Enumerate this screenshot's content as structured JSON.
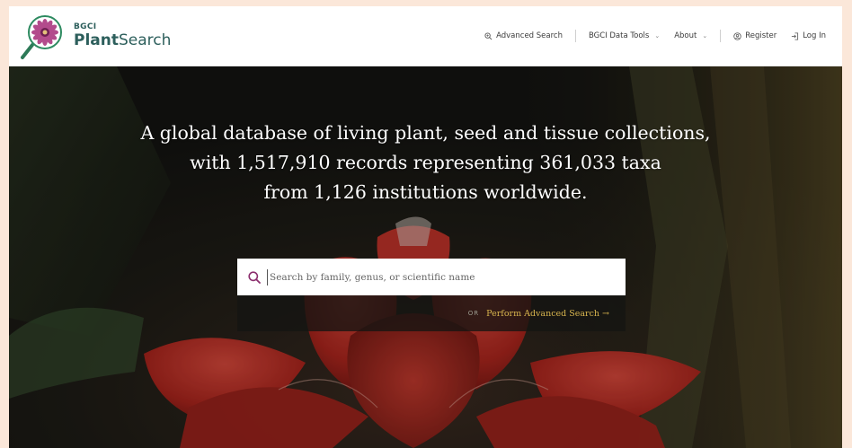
{
  "header": {
    "logo_small": "BGCI",
    "logo_name_bold": "Plant",
    "logo_name_rest": "Search",
    "nav": {
      "advanced_search": "Advanced Search",
      "data_tools": "BGCI Data Tools",
      "about": "About",
      "register": "Register",
      "login": "Log In"
    }
  },
  "hero": {
    "headline_line1": "A global database of living plant, seed and tissue collections,",
    "headline_line2": "with 1,517,910 records representing 361,033 taxa",
    "headline_line3": "from 1,126 institutions worldwide."
  },
  "search": {
    "placeholder": "Search by family, genus, or scientific name",
    "or_label": "OR",
    "advanced_link": "Perform Advanced Search →"
  },
  "colors": {
    "brand": "#2d5f5c",
    "accent_magenta": "#8c2f6e",
    "link_gold": "#d8b54e"
  }
}
